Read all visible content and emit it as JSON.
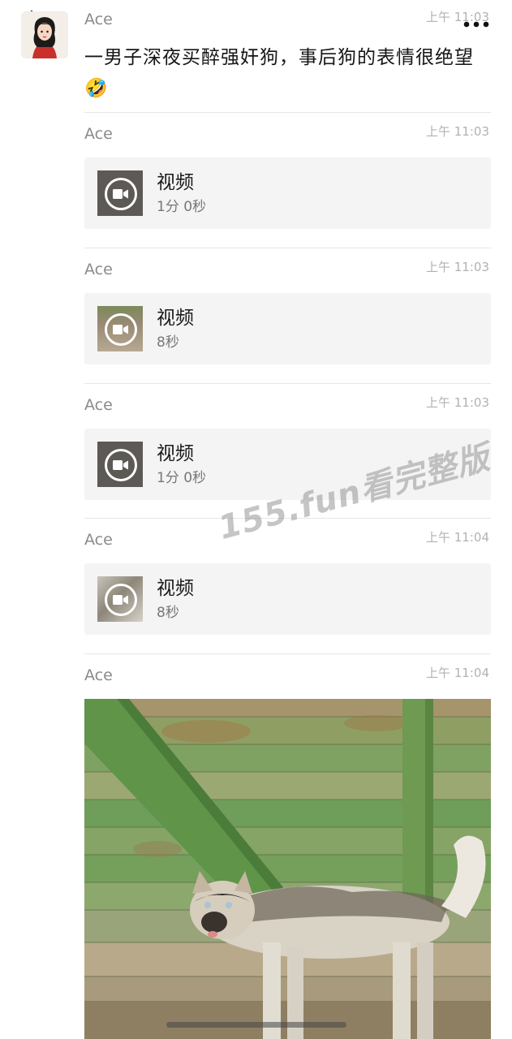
{
  "top_bar": {
    "back_icon": "chevron-left-icon",
    "more_icon": "ellipsis-icon"
  },
  "messages": [
    {
      "sender": "Ace",
      "time": "上午 11:03",
      "text": "一男子深夜买醉强奸狗，事后狗的表情很绝望",
      "emoji": "🤣"
    },
    {
      "sender": "Ace",
      "time": "上午 11:03",
      "video_title": "视频",
      "duration": "1分 0秒"
    },
    {
      "sender": "Ace",
      "time": "上午 11:03",
      "video_title": "视频",
      "duration": "8秒"
    },
    {
      "sender": "Ace",
      "time": "上午 11:03",
      "video_title": "视频",
      "duration": "1分 0秒"
    },
    {
      "sender": "Ace",
      "time": "上午 11:04",
      "video_title": "视频",
      "duration": "8秒"
    },
    {
      "sender": "Ace",
      "time": "上午 11:04",
      "image": "dog-photo"
    }
  ],
  "watermark": "155.fun看完整版",
  "colors": {
    "card_bg": "#f4f4f4",
    "secondary_text": "#8a8a8a",
    "time_text": "#b2b2b2"
  }
}
